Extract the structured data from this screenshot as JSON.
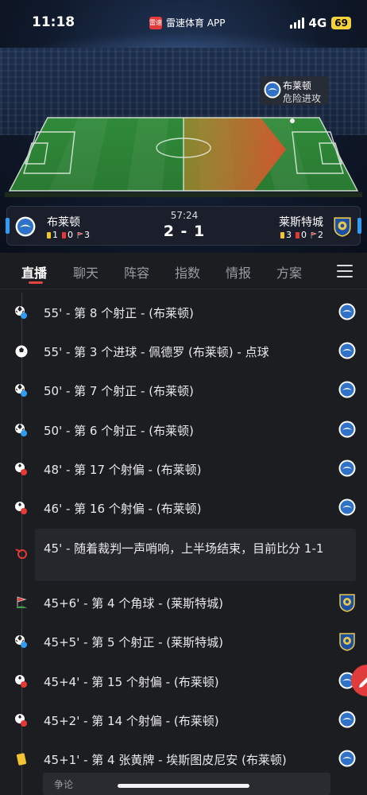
{
  "status_bar": {
    "time": "11:18",
    "app_label": "雷速体育 APP",
    "app_logo_text": "雷速",
    "network": "4G",
    "battery": "69"
  },
  "pitch": {
    "ad_text": "雷速体育"
  },
  "danger_popup": {
    "team": "布莱顿",
    "text": "危险进攻"
  },
  "match": {
    "clock": "57:24",
    "score": "2 - 1",
    "home": {
      "name": "布莱顿",
      "yellow": "1",
      "red": "0",
      "corners": "3"
    },
    "away": {
      "name": "莱斯特城",
      "yellow": "3",
      "red": "0",
      "corners": "2"
    }
  },
  "tabs": [
    "直播",
    "聊天",
    "阵容",
    "指数",
    "情报",
    "方案"
  ],
  "events": [
    {
      "icon": "shot-on-target",
      "text": "55' - 第 8 个射正 - (布莱顿)",
      "team": "home"
    },
    {
      "icon": "goal",
      "text": "55' - 第 3 个进球 - 佩德罗 (布莱顿) - 点球",
      "team": "home"
    },
    {
      "icon": "shot-on-target",
      "text": "50' - 第 7 个射正 - (布莱顿)",
      "team": "home"
    },
    {
      "icon": "shot-on-target",
      "text": "50' - 第 6 个射正 - (布莱顿)",
      "team": "home"
    },
    {
      "icon": "shot-off-target",
      "text": "48' - 第 17 个射偏 - (布莱顿)",
      "team": "home"
    },
    {
      "icon": "shot-off-target",
      "text": "46' - 第 16 个射偏 - (布莱顿)",
      "team": "home"
    },
    {
      "icon": "whistle",
      "text": "45' - 随着裁判一声哨响，上半场结束，目前比分 1-1",
      "team": ""
    },
    {
      "icon": "corner",
      "text": "45+6' - 第 4 个角球 - (莱斯特城)",
      "team": "away"
    },
    {
      "icon": "shot-on-target",
      "text": "45+5' - 第 5 个射正 - (莱斯特城)",
      "team": "away"
    },
    {
      "icon": "shot-off-target",
      "text": "45+4' - 第 15 个射偏 - (布莱顿)",
      "team": "home"
    },
    {
      "icon": "shot-off-target",
      "text": "45+2' - 第 14 个射偏 - (布莱顿)",
      "team": "home"
    },
    {
      "icon": "yellow-card",
      "text": "45+1' - 第 4 张黄牌 - 埃斯图皮尼安 (布莱顿)",
      "team": "home"
    }
  ],
  "comment_placeholder": "争论",
  "colors": {
    "accent": "#e0463f",
    "brighton": "#2f9df4",
    "leicester": "#1d4fa3",
    "background": "#1c1d21"
  }
}
